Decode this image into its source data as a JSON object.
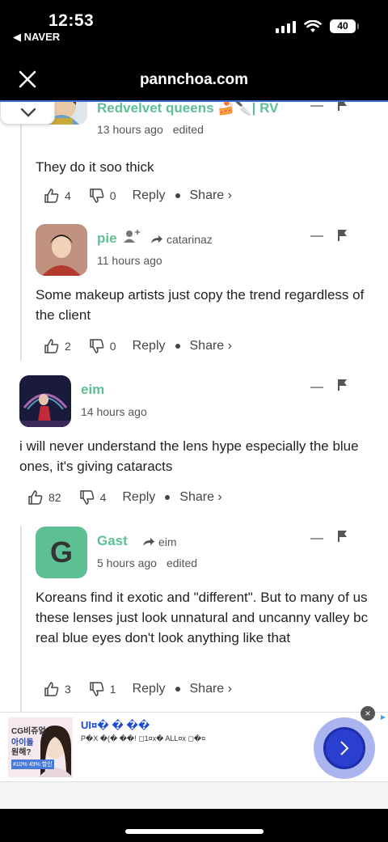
{
  "status": {
    "time": "12:53",
    "back_app": "◀ NAVER",
    "battery": "40"
  },
  "browser": {
    "title": "pannchoa.com"
  },
  "comments": [
    {
      "name": "Redvelvet queens 🍰🔪| RV",
      "time": "13 hours ago",
      "edited": "edited",
      "body": "They do it soo thick",
      "likes": "4",
      "dislikes": "0",
      "reply": "Reply",
      "share": "Share ›"
    },
    {
      "name": "pie",
      "reply_to": "catarinaz",
      "time": "11 hours ago",
      "body": "Some makeup artists just copy the trend regardless of the client",
      "likes": "2",
      "dislikes": "0",
      "reply": "Reply",
      "share": "Share ›"
    },
    {
      "name": "eim",
      "time": "14 hours ago",
      "body": "i will never understand the lens hype especially the blue ones, it's giving cataracts",
      "likes": "82",
      "dislikes": "4",
      "reply": "Reply",
      "share": "Share ›"
    },
    {
      "name": "Gast",
      "avatar_letter": "G",
      "reply_to": "eim",
      "time": "5 hours ago",
      "edited": "edited",
      "body": "Koreans find it exotic and \"different\". But to many of us these lenses just look unnatural and uncanny valley bc real blue eyes don't look anything like that",
      "likes": "3",
      "dislikes": "1",
      "reply": "Reply",
      "share": "Share ›"
    }
  ],
  "ad": {
    "img_line1": "CG비쥬얼",
    "img_line2": "아이돌",
    "img_line3": "원해?",
    "img_badge": "#10% 49% 할인",
    "title": "UI¤� � ��",
    "desc": "P�X �(� ��! ◻1¤x� ALL¤x ◻�¤",
    "close": "×"
  },
  "colors": {
    "accent": "#5fbf94",
    "link_blue": "#3b6fd4"
  }
}
